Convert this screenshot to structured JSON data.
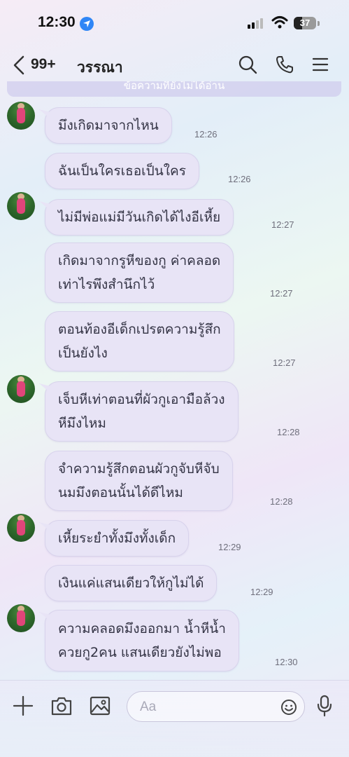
{
  "status_bar": {
    "time": "12:30",
    "battery": "37"
  },
  "header": {
    "unread_count": "99+",
    "chat_name": "วรรณา"
  },
  "notice": {
    "text": "ข้อความที่ยังไม่ได้อ่าน"
  },
  "messages": [
    {
      "text": "มึงเกิดมาจากไหน",
      "time": "12:26"
    },
    {
      "text": "ฉันเป็นใครเธอเป็นใคร",
      "time": "12:26"
    },
    {
      "text": "ไม่มีพ่อแม่มีวันเกิดได้ไงอีเหี้ย",
      "time": "12:27"
    },
    {
      "line1": "เกิดมาจากรูหีของกู ค่าคลอด",
      "line2": "เท่าไรพึงสำนึกไว้",
      "time": "12:27"
    },
    {
      "line1": "ตอนท้องอีเด็กเปรตความรู้สึก",
      "line2": "เป็นยังไง",
      "time": "12:27"
    },
    {
      "line1": "เจ็บหีเท่าตอนที่ผัวกูเอามือล้วง",
      "line2": "หีมึงไหม",
      "time": "12:28"
    },
    {
      "line1": "จำความรู้สึกตอนผัวกูจับหีจับ",
      "line2": "นมมึงตอนนั้นได้ดีไหม",
      "time": "12:28"
    },
    {
      "text": "เหี้ยระยำทั้งมึงทั้งเด็ก",
      "time": "12:29"
    },
    {
      "text": "เงินแค่แสนเดียวให้กูไม่ได้",
      "time": "12:29"
    },
    {
      "line1": "ความคลอดมึงออกมา น้ำหีน้ำ",
      "line2": "ควยกู2คน แสนเดียวยังไม่พอ",
      "time": "12:30"
    }
  ],
  "composer": {
    "placeholder": "Aa"
  },
  "icons": {
    "back": "chevron-left-icon",
    "search": "search-icon",
    "call": "phone-icon",
    "menu": "menu-icon",
    "add": "plus-icon",
    "camera": "camera-icon",
    "gallery": "image-icon",
    "emoji": "emoji-icon",
    "voice": "microphone-icon"
  },
  "colors": {
    "bubble": "#e8e4f6",
    "location_arrow": "#2f86f6"
  }
}
